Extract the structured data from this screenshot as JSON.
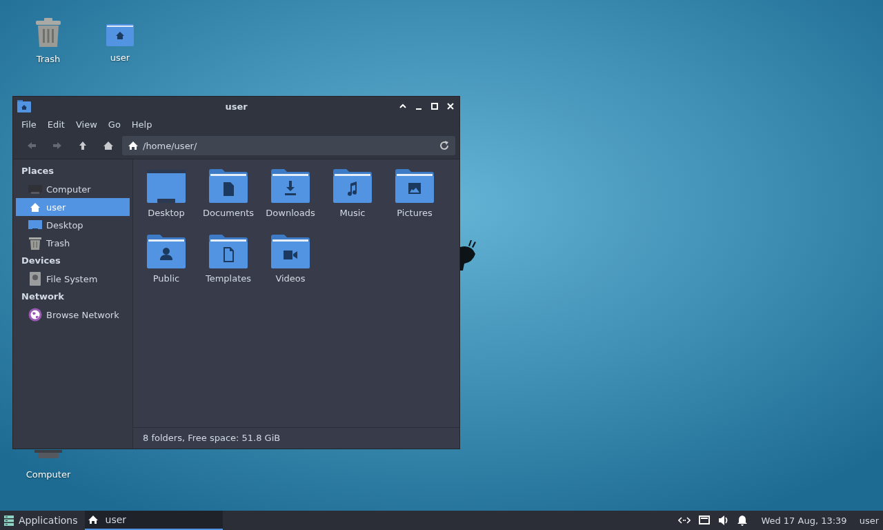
{
  "desktop_icons": [
    {
      "label": "Trash",
      "kind": "trash"
    },
    {
      "label": "user",
      "kind": "home"
    },
    {
      "label": "Computer",
      "kind": "computer"
    }
  ],
  "window": {
    "title": "user",
    "menu": [
      "File",
      "Edit",
      "View",
      "Go",
      "Help"
    ],
    "nav_buttons": [
      {
        "kind": "back",
        "disabled": true
      },
      {
        "kind": "forward",
        "disabled": true
      },
      {
        "kind": "up",
        "disabled": false
      },
      {
        "kind": "home",
        "disabled": false
      }
    ],
    "location": "/home/user/",
    "sidebar": [
      {
        "title": "Places",
        "items": [
          {
            "label": "Computer",
            "kind": "computer",
            "selected": false
          },
          {
            "label": "user",
            "kind": "home",
            "selected": true
          },
          {
            "label": "Desktop",
            "kind": "desktop",
            "selected": false
          },
          {
            "label": "Trash",
            "kind": "trash",
            "selected": false
          }
        ]
      },
      {
        "title": "Devices",
        "items": [
          {
            "label": "File System",
            "kind": "drive",
            "selected": false
          }
        ]
      },
      {
        "title": "Network",
        "items": [
          {
            "label": "Browse Network",
            "kind": "network",
            "selected": false
          }
        ]
      }
    ],
    "files": [
      {
        "label": "Desktop",
        "kind": "desktop"
      },
      {
        "label": "Documents",
        "kind": "documents"
      },
      {
        "label": "Downloads",
        "kind": "downloads"
      },
      {
        "label": "Music",
        "kind": "music"
      },
      {
        "label": "Pictures",
        "kind": "pictures"
      },
      {
        "label": "Public",
        "kind": "public"
      },
      {
        "label": "Templates",
        "kind": "templates"
      },
      {
        "label": "Videos",
        "kind": "videos"
      }
    ],
    "status_bar": "8 folders, Free space: 51.8 GiB"
  },
  "taskbar": {
    "menu_label": "Applications",
    "tasks": [
      {
        "label": "user",
        "selected": true
      }
    ],
    "clock": "Wed 17 Aug, 13:39",
    "user": "user"
  }
}
